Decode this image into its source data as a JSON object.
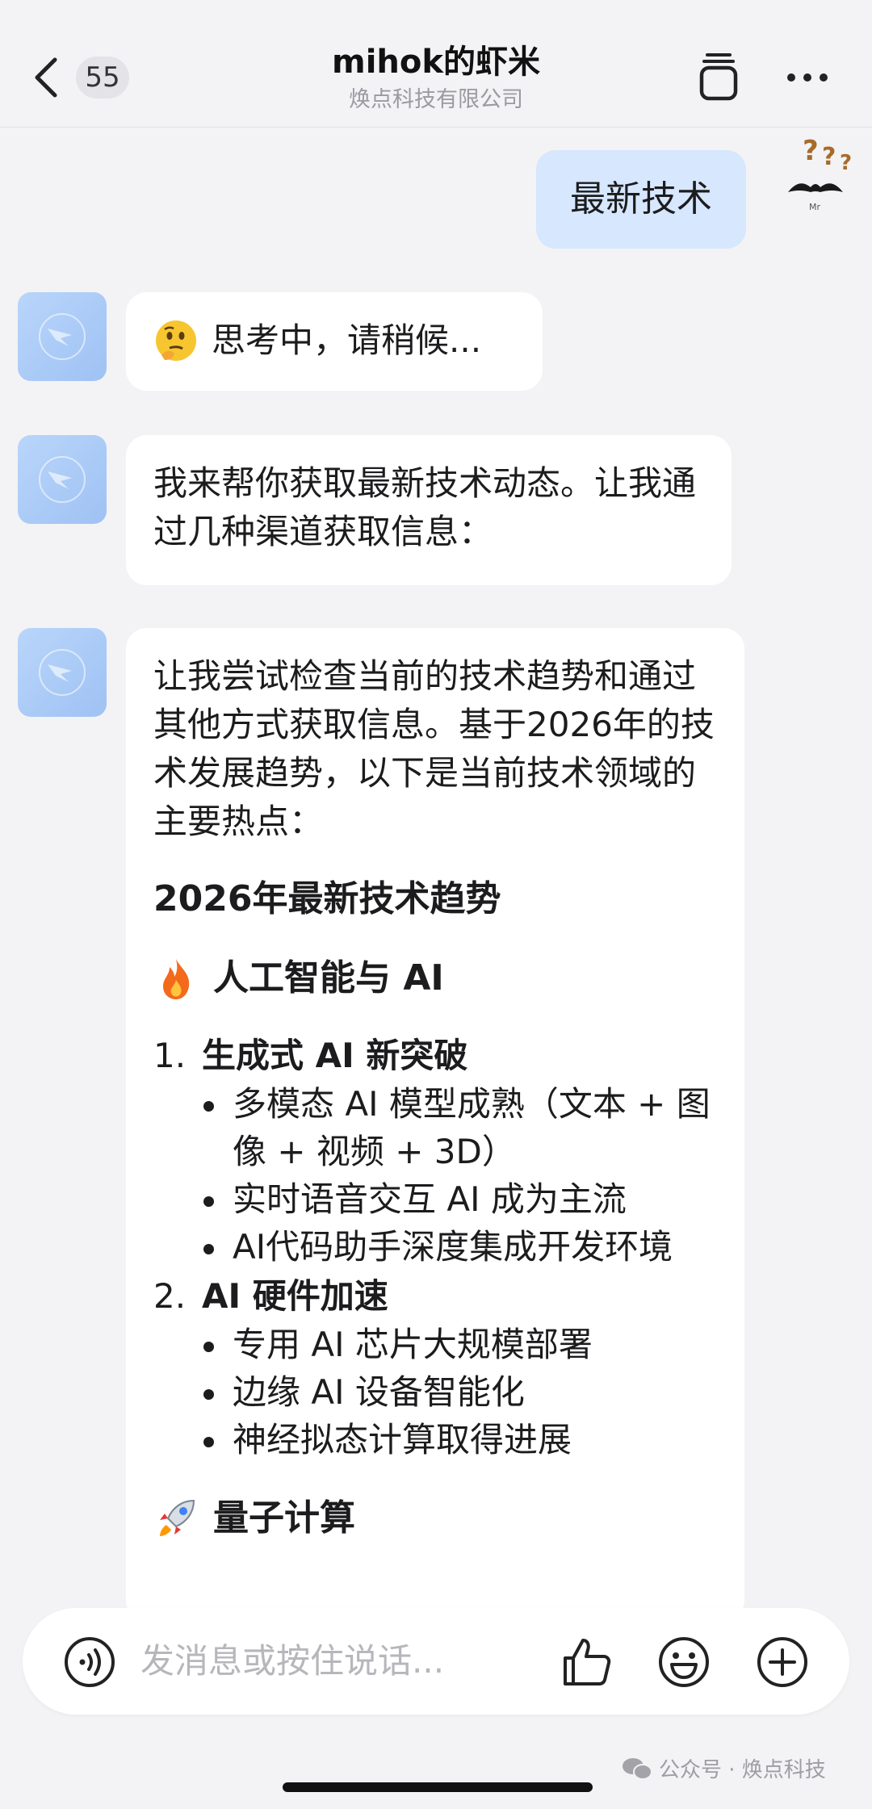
{
  "header": {
    "unread_count": "55",
    "title": "mihok的虾米",
    "subtitle": "焕点科技有限公司"
  },
  "messages": {
    "user_message": "最新技术",
    "thinking": "思考中，请稍候...",
    "reply_1": "我来帮你获取最新技术动态。让我通过几种渠道获取信息：",
    "reply_2": {
      "intro": "让我尝试检查当前的技术趋势和通过其他方式获取信息。基于2026年的技术发展趋势，以下是当前技术领域的主要热点：",
      "heading": "2026年最新技术趋势",
      "section_1": {
        "icon": "fire-emoji",
        "title": "人工智能与 AI",
        "items": [
          {
            "num": "1.",
            "title": "生成式 AI 新突破",
            "bullets": [
              "多模态 AI 模型成熟（文本 + 图像 + 视频 + 3D）",
              "实时语音交互 AI 成为主流",
              "AI代码助手深度集成开发环境"
            ]
          },
          {
            "num": "2.",
            "title": "AI 硬件加速",
            "bullets": [
              "专用 AI 芯片大规模部署",
              "边缘 AI 设备智能化",
              "神经拟态计算取得进展"
            ]
          }
        ]
      },
      "section_2": {
        "icon": "rocket-emoji",
        "title": "量子计算"
      }
    }
  },
  "input": {
    "placeholder": "发消息或按住说话..."
  },
  "watermark": "公众号 · 焕点科技",
  "colors": {
    "background": "#f3f3f5",
    "user_bubble": "#d7e7fd",
    "bot_bubble": "#ffffff",
    "bot_avatar": "#a9cbf7"
  }
}
